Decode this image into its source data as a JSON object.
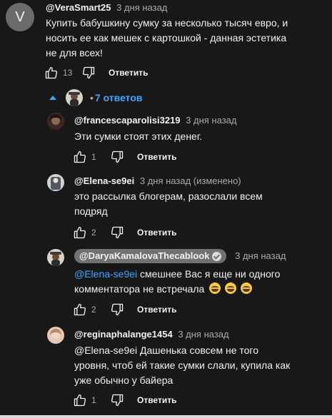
{
  "main_comment": {
    "avatar_letter": "V",
    "author": "@VeraSmart25",
    "timestamp": "3 дня назад",
    "text": "Купить бабушкину сумку за несколько тысяч евро, и\nносить ее как мешек с картошкой - данная эстетика\nне для всех!",
    "likes": "13",
    "reply_label": "Ответить"
  },
  "replies_toggle": {
    "label": "7 ответов",
    "separator": "•"
  },
  "replies": [
    {
      "author": "@francescaparolisi3219",
      "timestamp": "3 дня назад",
      "text": "Эти сумки стоят этих денег.",
      "likes": "1",
      "reply_label": "Ответить"
    },
    {
      "author": "@Elena-se9ei",
      "timestamp": "3 дня назад (изменено)",
      "text": "это рассылка блогерам, разослали всем\nподряд",
      "likes": "2",
      "reply_label": "Ответить"
    },
    {
      "author": "@DaryaKamalovaThecablook",
      "timestamp": "3 дня назад",
      "mention": "@Elena-se9ei",
      "text_line1": "смешнее Вас я еще ни одного",
      "text_line2": "комментатора не встречала",
      "emoji_name": "rolling-laughing-emoji",
      "likes": "2",
      "reply_label": "Ответить"
    },
    {
      "author": "@reginaphalange1454",
      "timestamp": "3 дня назад",
      "text": "@Elena-se9ei  Дашенька совсем не того\nуровня, чтоб ей такие сумки слали, купила как\nуже обычно у байера",
      "likes": "1",
      "reply_label": "Ответить"
    }
  ],
  "icons": {
    "like": "thumbs-up-icon",
    "dislike": "thumbs-down-icon",
    "collapse": "chevron-up-icon",
    "verified": "verified-check-icon"
  },
  "colors": {
    "background": "#181818",
    "link": "#3ea6ff",
    "text_primary": "#f1f1f1",
    "text_secondary": "#aaaaaa"
  }
}
